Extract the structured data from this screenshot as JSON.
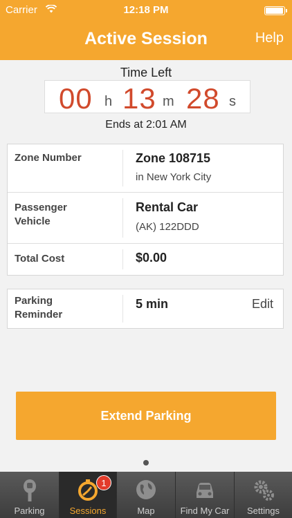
{
  "status_bar": {
    "carrier": "Carrier",
    "time": "12:18 PM",
    "battery_level": 1.0
  },
  "nav": {
    "title": "Active Session",
    "help_label": "Help"
  },
  "timer": {
    "heading": "Time Left",
    "hours": "00",
    "hours_unit": "h",
    "minutes": "13",
    "minutes_unit": "m",
    "seconds": "28",
    "seconds_unit": "s",
    "ends_text": "Ends at 2:01 AM"
  },
  "details": {
    "zone_label": "Zone Number",
    "zone_value": "Zone 108715",
    "zone_city": "in New York City",
    "vehicle_label_line1": "Passenger",
    "vehicle_label_line2": "Vehicle",
    "vehicle_value": "Rental Car",
    "vehicle_plate": "(AK) 122DDD",
    "cost_label": "Total Cost",
    "cost_value": "$0.00"
  },
  "reminder": {
    "label_line1": "Parking",
    "label_line2": "Reminder",
    "value": "5 min",
    "edit_label": "Edit"
  },
  "extend_button": {
    "label": "Extend Parking"
  },
  "tabs": [
    {
      "label": "Parking",
      "icon": "parking-meter-icon"
    },
    {
      "label": "Sessions",
      "icon": "timer-clock-icon",
      "badge": "1"
    },
    {
      "label": "Map",
      "icon": "globe-icon"
    },
    {
      "label": "Find My Car",
      "icon": "car-icon"
    },
    {
      "label": "Settings",
      "icon": "gears-icon"
    }
  ],
  "colors": {
    "accent": "#f5a72f",
    "timer_digits": "#d14a2c",
    "badge": "#e23b2a"
  }
}
